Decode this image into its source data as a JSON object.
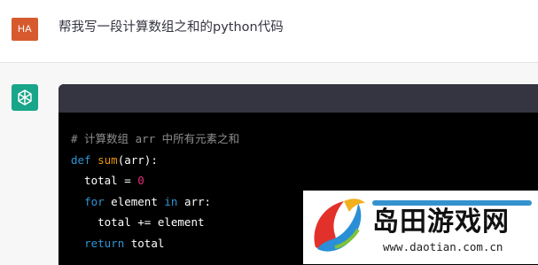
{
  "user": {
    "avatar_initials": "HA",
    "message": "帮我写一段计算数组之和的python代码"
  },
  "assistant": {
    "icon": "openai-logo-icon",
    "code_lines": {
      "l1_comment": "# 计算数组 arr 中所有元素之和",
      "l2_def": "def",
      "l2_fn": "sum",
      "l2_rest": "(arr):",
      "l3_indent": "  total = ",
      "l3_num": "0",
      "l4_indent": "  ",
      "l4_for": "for",
      "l4_mid": " element ",
      "l4_in": "in",
      "l4_rest": " arr:",
      "l5": "    total += element",
      "l6_indent": "  ",
      "l6_return": "return",
      "l6_rest": " total"
    }
  },
  "watermark": {
    "title": "岛田游戏网",
    "url": "www.daotian.com.cn"
  },
  "colors": {
    "avatar_bg": "#d65a2d",
    "gpt_icon_bg": "#19a589",
    "code_bg": "#000000",
    "code_header_bg": "#343541",
    "keyword": "#2e95d3",
    "function": "#e9950c",
    "number": "#df3079"
  }
}
